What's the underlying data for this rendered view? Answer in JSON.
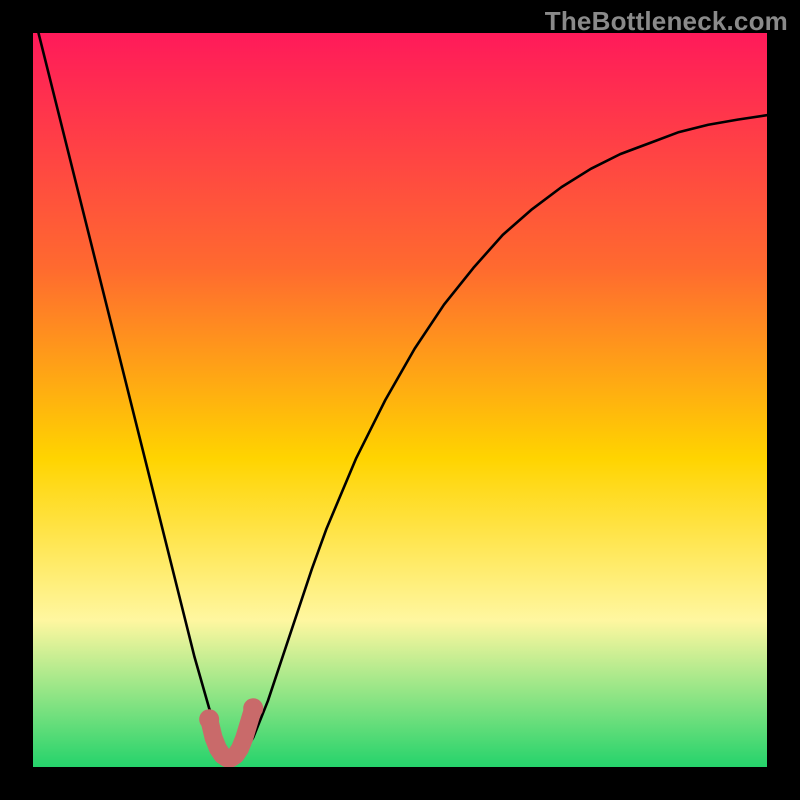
{
  "watermark": "TheBottleneck.com",
  "colors": {
    "frame": "#000000",
    "gradient_top": "#ff1a5a",
    "gradient_mid1": "#ff6a2f",
    "gradient_mid2": "#ffd400",
    "gradient_mid3": "#fff7a0",
    "gradient_bottom": "#25d36b",
    "curve": "#000000",
    "marker": "#c96a6a"
  },
  "chart_data": {
    "type": "line",
    "title": "",
    "xlabel": "",
    "ylabel": "",
    "xlim": [
      0,
      100
    ],
    "ylim": [
      0,
      100
    ],
    "series": [
      {
        "name": "bottleneck-curve",
        "x": [
          0,
          2,
          4,
          6,
          8,
          10,
          12,
          14,
          16,
          18,
          20,
          22,
          24,
          25.5,
          27,
          28.5,
          30,
          32,
          34,
          36,
          38,
          40,
          44,
          48,
          52,
          56,
          60,
          64,
          68,
          72,
          76,
          80,
          84,
          88,
          92,
          96,
          100
        ],
        "y": [
          103,
          95,
          87,
          79,
          71,
          63,
          55,
          47,
          39,
          31,
          23,
          15,
          8,
          4,
          1.5,
          1.5,
          4,
          9,
          15,
          21,
          27,
          32.5,
          42,
          50,
          57,
          63,
          68,
          72.5,
          76,
          79,
          81.5,
          83.5,
          85,
          86.5,
          87.5,
          88.2,
          88.8
        ]
      },
      {
        "name": "minimum-marker",
        "x": [
          24.0,
          24.6,
          25.2,
          25.8,
          26.4,
          27.0,
          27.6,
          28.2,
          28.8,
          29.4,
          30.0
        ],
        "y": [
          6.5,
          4.0,
          2.5,
          1.6,
          1.2,
          1.2,
          1.6,
          2.5,
          4.0,
          6.0,
          8.0
        ]
      }
    ],
    "annotations": []
  }
}
